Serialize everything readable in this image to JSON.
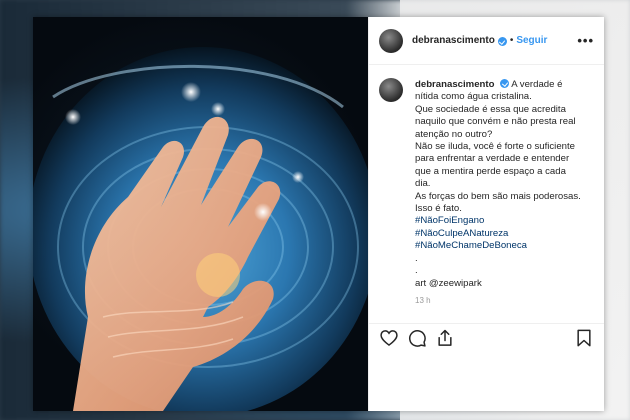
{
  "post": {
    "username": "debranascimento",
    "separator": "•",
    "follow_label": "Seguir",
    "more_label": "•••",
    "caption": {
      "username": "debranascimento",
      "lines": [
        "A verdade é",
        "nítida como água cristalina.",
        "Que sociedade é essa que acredita",
        "naquilo que convém e não presta real",
        "atenção no outro?",
        "Não se iluda, você é forte o suficiente",
        "para enfrentar a verdade e entender",
        "que a mentira perde espaço a cada",
        "dia.",
        "As forças do bem são mais poderosas.",
        "Isso é fato."
      ],
      "hashtags": [
        "#NãoFoiEngano",
        "#NãoCulpeANatureza",
        "#NãoMeChameDeBoneca"
      ],
      "dots": [
        ".",
        "."
      ],
      "credit": "art @zeewipark"
    },
    "timestamp": "13 h"
  },
  "icons": {
    "like": "heart-icon",
    "comment": "comment-icon",
    "share": "share-icon",
    "save": "bookmark-icon",
    "verified": "verified-badge-icon"
  },
  "colors": {
    "link_blue": "#3897f0",
    "hashtag_blue": "#003569",
    "text": "#262626"
  }
}
